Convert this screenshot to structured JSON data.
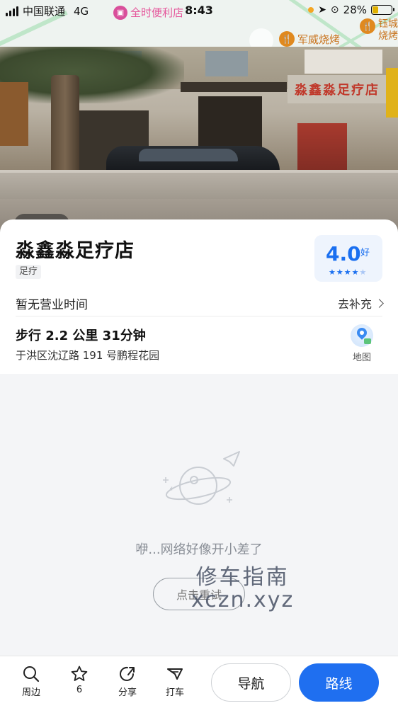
{
  "status_bar": {
    "carrier": "中国联通",
    "network": "4G",
    "time": "8:43",
    "battery": "28%"
  },
  "map": {
    "poi_top": "全时便利店",
    "food_poi_1": "军威烧烤",
    "food_poi_2_line1": "钰城",
    "food_poi_2_line2": "烧烤"
  },
  "photo": {
    "shop_sign": "淼鑫淼足疗店"
  },
  "place": {
    "name": "淼鑫淼足疗店",
    "category_tag": "足疗",
    "rating": "4.0",
    "rating_word": "好",
    "rating_stars": 4,
    "hours": "暂无营业时间",
    "supplement_label": "去补充",
    "walk_info": "步行 2.2 公里   31分钟",
    "address": "于洪区沈辽路 191 号鹏程花园",
    "map_label": "地图"
  },
  "error": {
    "message": "咿...网络好像开小差了",
    "retry_label": "点击重试"
  },
  "watermark": {
    "line1": "修车指南",
    "line2": "xczn.xyz"
  },
  "bottom_bar": {
    "nearby": "周边",
    "favorites_count": "6",
    "share": "分享",
    "taxi": "打车",
    "navigate": "导航",
    "route": "路线"
  }
}
